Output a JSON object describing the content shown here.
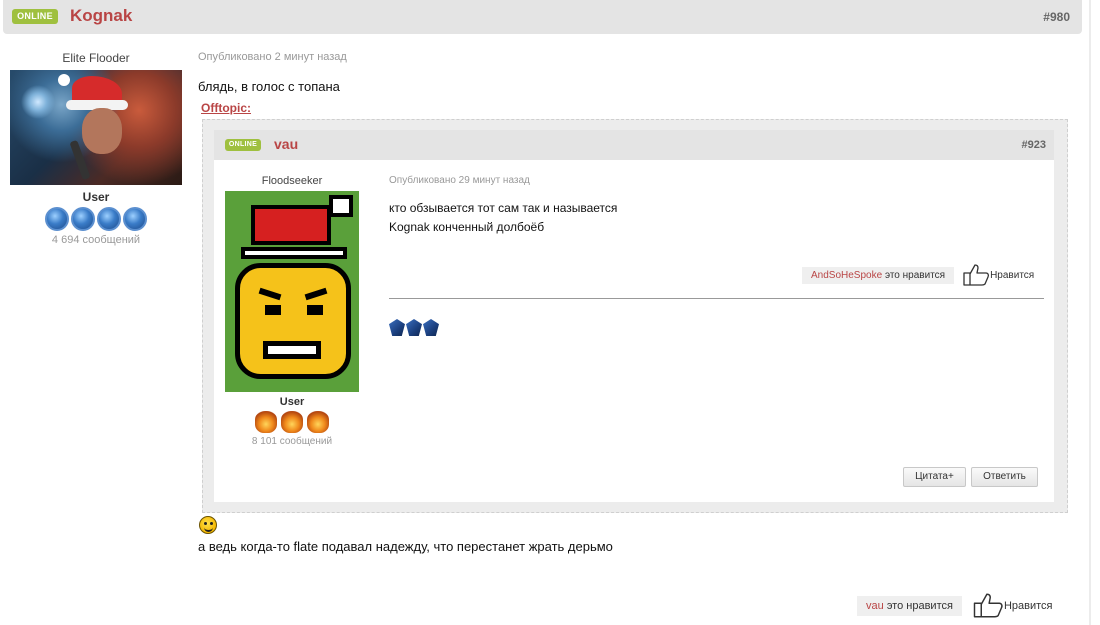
{
  "post": {
    "status": "ONLINE",
    "author": "Kognak",
    "number": "#980",
    "author_rank": "Elite Flooder",
    "author_group": "User",
    "author_post_count": "4 694 сообщений",
    "published": "Опубликовано 2 минут назад",
    "text_line1": "блядь, в голос с топана",
    "spoiler_label": "Offtopic:",
    "text_line2": "а ведь когда-то flate подавал надежду, что перестанет жрать дерьмо",
    "liker": "vau",
    "liked_text": "это нравится",
    "like_label": "Нравится"
  },
  "quoted_post": {
    "status": "ONLINE",
    "author": "vau",
    "number": "#923",
    "author_rank": "Floodseeker",
    "author_group": "User",
    "author_post_count": "8 101 сообщений",
    "published": "Опубликовано 29 минут назад",
    "text_line1": "кто обзывается тот сам так и называется",
    "text_line2": "Kognak конченный долбоёб",
    "liker": "AndSoHeSpoke",
    "liked_text": "это нравится",
    "like_label": "Нравится",
    "quote_button": "Цитата+",
    "reply_button": "Ответить"
  },
  "colors": {
    "online_badge": "#9fc03f",
    "username": "#b94545",
    "header_bg": "#e4e4e4"
  }
}
